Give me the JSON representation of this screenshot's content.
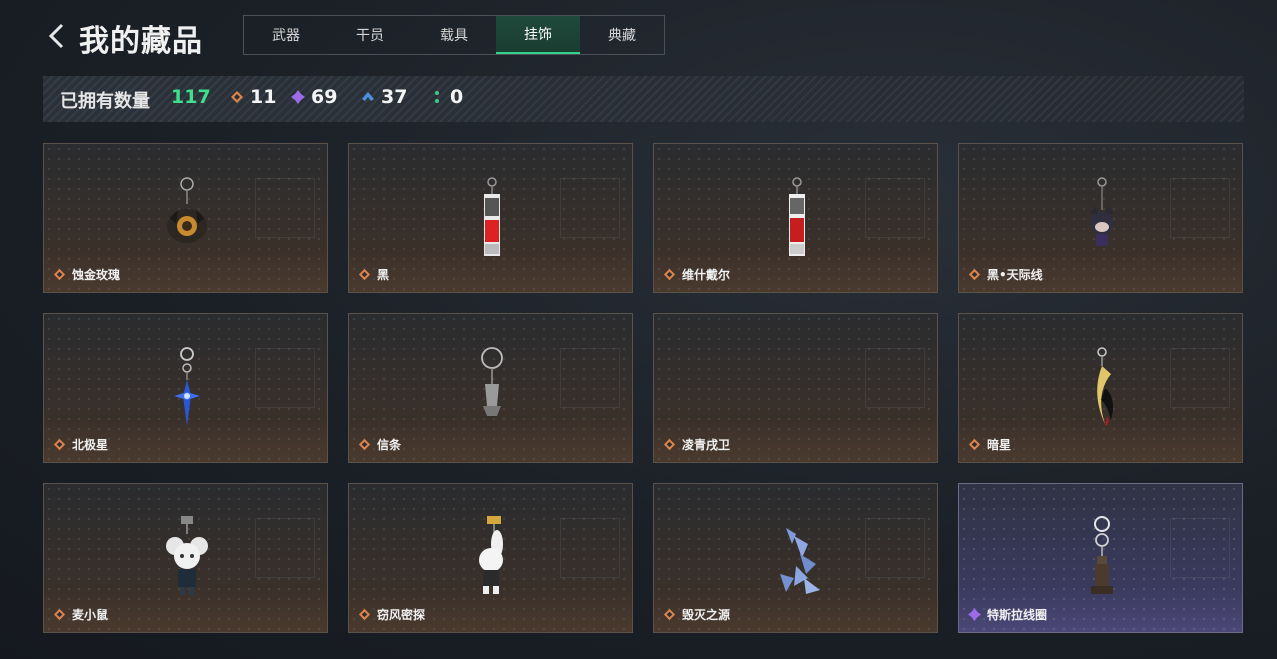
{
  "header": {
    "title": "我的藏品",
    "tabs": [
      {
        "label": "武器",
        "active": false
      },
      {
        "label": "干员",
        "active": false
      },
      {
        "label": "载具",
        "active": false
      },
      {
        "label": "挂饰",
        "active": true
      },
      {
        "label": "典藏",
        "active": false
      }
    ]
  },
  "stats": {
    "label": "已拥有数量",
    "total": "117",
    "rarities": [
      {
        "icon": "orange-diamond-icon",
        "color": "#e0834a",
        "count": "11"
      },
      {
        "icon": "purple-diamond-icon",
        "color": "#9b6be8",
        "count": "69"
      },
      {
        "icon": "blue-chevron-icon",
        "color": "#4f8fe0",
        "count": "37"
      },
      {
        "icon": "green-dots-icon",
        "color": "#3ec98a",
        "count": "0"
      }
    ]
  },
  "items": [
    {
      "name": "蚀金玫瑰",
      "rarity": "orange",
      "art": "rose-pendant-icon"
    },
    {
      "name": "黑",
      "rarity": "orange",
      "art": "card-pendant-icon"
    },
    {
      "name": "维什戴尔",
      "rarity": "orange",
      "art": "card-pendant-icon"
    },
    {
      "name": "黑•天际线",
      "rarity": "orange",
      "art": "figure-pendant-icon"
    },
    {
      "name": "北极星",
      "rarity": "orange",
      "art": "star-pendant-icon"
    },
    {
      "name": "信条",
      "rarity": "orange",
      "art": "silver-pendant-icon"
    },
    {
      "name": "凌青戌卫",
      "rarity": "orange",
      "art": "empty"
    },
    {
      "name": "暗星",
      "rarity": "orange",
      "art": "crescent-pendant-icon"
    },
    {
      "name": "麦小鼠",
      "rarity": "orange",
      "art": "mouse-pendant-icon"
    },
    {
      "name": "窃风密探",
      "rarity": "orange",
      "art": "bunny-pendant-icon"
    },
    {
      "name": "毁灭之源",
      "rarity": "orange",
      "art": "crystal-pendant-icon"
    },
    {
      "name": "特斯拉线圈",
      "rarity": "purple",
      "art": "coil-pendant-icon"
    }
  ]
}
